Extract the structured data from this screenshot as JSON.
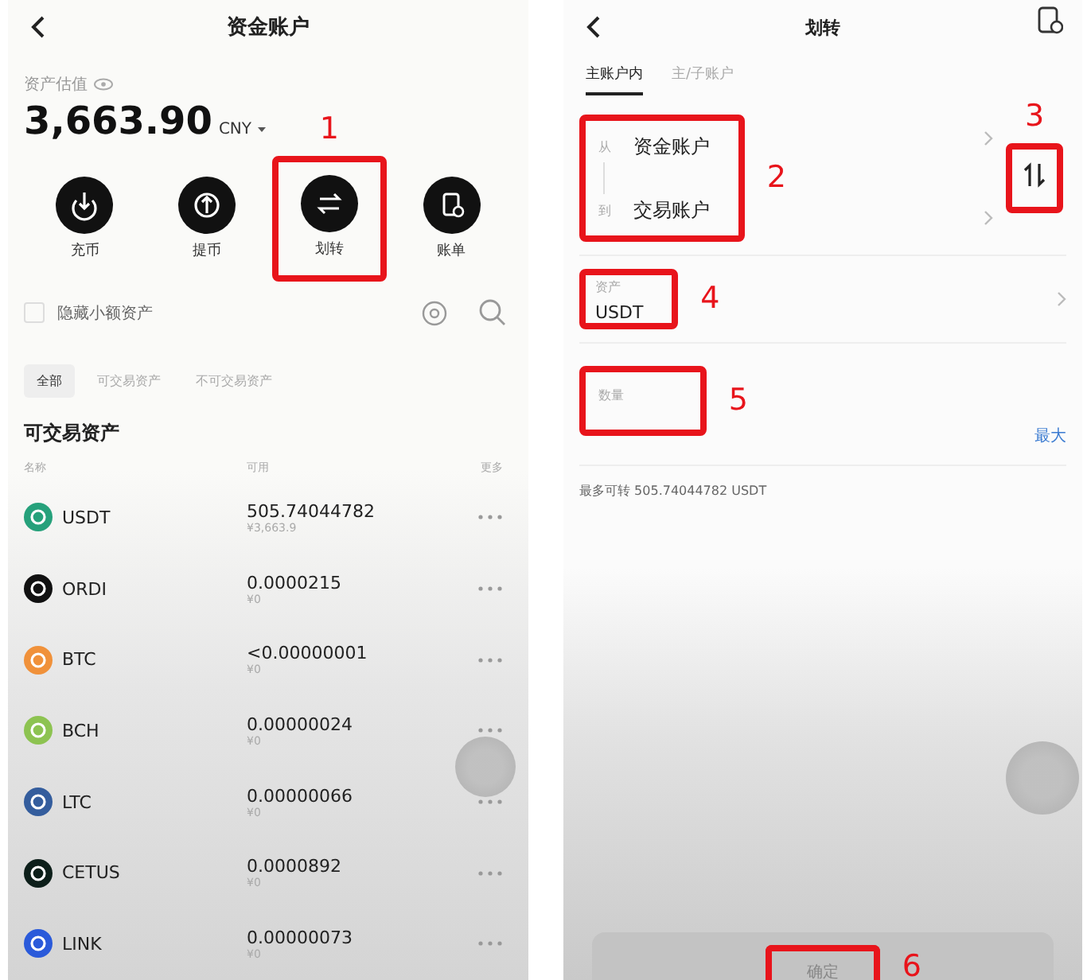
{
  "funds_screen": {
    "title": "资金账户",
    "valuation_label": "资产估值",
    "total": "3,663.90",
    "currency": "CNY",
    "actions": [
      {
        "label": "充币",
        "kind": "deposit"
      },
      {
        "label": "提币",
        "kind": "withdraw"
      },
      {
        "label": "划转",
        "kind": "transfer",
        "annotation": {
          "number": "1",
          "kind": "above"
        }
      },
      {
        "label": "账单",
        "kind": "bill"
      }
    ],
    "hide_small": {
      "label": "隐藏小额资产",
      "checked": false
    },
    "filters": [
      {
        "label": "全部",
        "selected": true
      },
      {
        "label": "可交易资产",
        "selected": false
      },
      {
        "label": "不可交易资产",
        "selected": false
      }
    ],
    "section_title": "可交易资产",
    "columns": [
      "名称",
      "可用",
      "更多"
    ],
    "rows": [
      {
        "name": "USDT",
        "color": "#26a17b",
        "amount": "505.74044782",
        "value": "¥3,663.9"
      },
      {
        "name": "ORDI",
        "color": "#111111",
        "amount": "0.0000215",
        "value": "¥0"
      },
      {
        "name": "BTC",
        "color": "#f0913a",
        "amount": "<0.00000001",
        "value": "¥0"
      },
      {
        "name": "BCH",
        "color": "#8dc351",
        "amount": "0.00000024",
        "value": "¥0"
      },
      {
        "name": "LTC",
        "color": "#345d9d",
        "amount": "0.00000066",
        "value": "¥0"
      },
      {
        "name": "CETUS",
        "color": "#0d1f1a",
        "amount": "0.0000892",
        "value": "¥0"
      },
      {
        "name": "LINK",
        "color": "#2a5ada",
        "amount": "0.00000073",
        "value": "¥0"
      }
    ]
  },
  "transfer_screen": {
    "title": "划转",
    "tabs": [
      {
        "label": "主账户内",
        "selected": true
      },
      {
        "label": "主/子账户",
        "selected": false
      }
    ],
    "from_label": "从",
    "from_account": "资金账户",
    "to_label": "到",
    "to_account": "交易账户",
    "accounts_annotation": {
      "number": "2",
      "kind": "beside"
    },
    "swap_annotation": {
      "number": "3",
      "kind": "above"
    },
    "asset_label": "资产",
    "asset_value": "USDT",
    "asset_annotation": {
      "number": "4",
      "kind": "beside"
    },
    "amount_label": "数量",
    "amount_annotation": {
      "number": "5",
      "kind": "beside"
    },
    "max_label": "最大",
    "available": "最多可转 505.74044782 USDT",
    "confirm": "确定",
    "confirm_annotation": {
      "number": "6",
      "kind": "beside"
    }
  }
}
